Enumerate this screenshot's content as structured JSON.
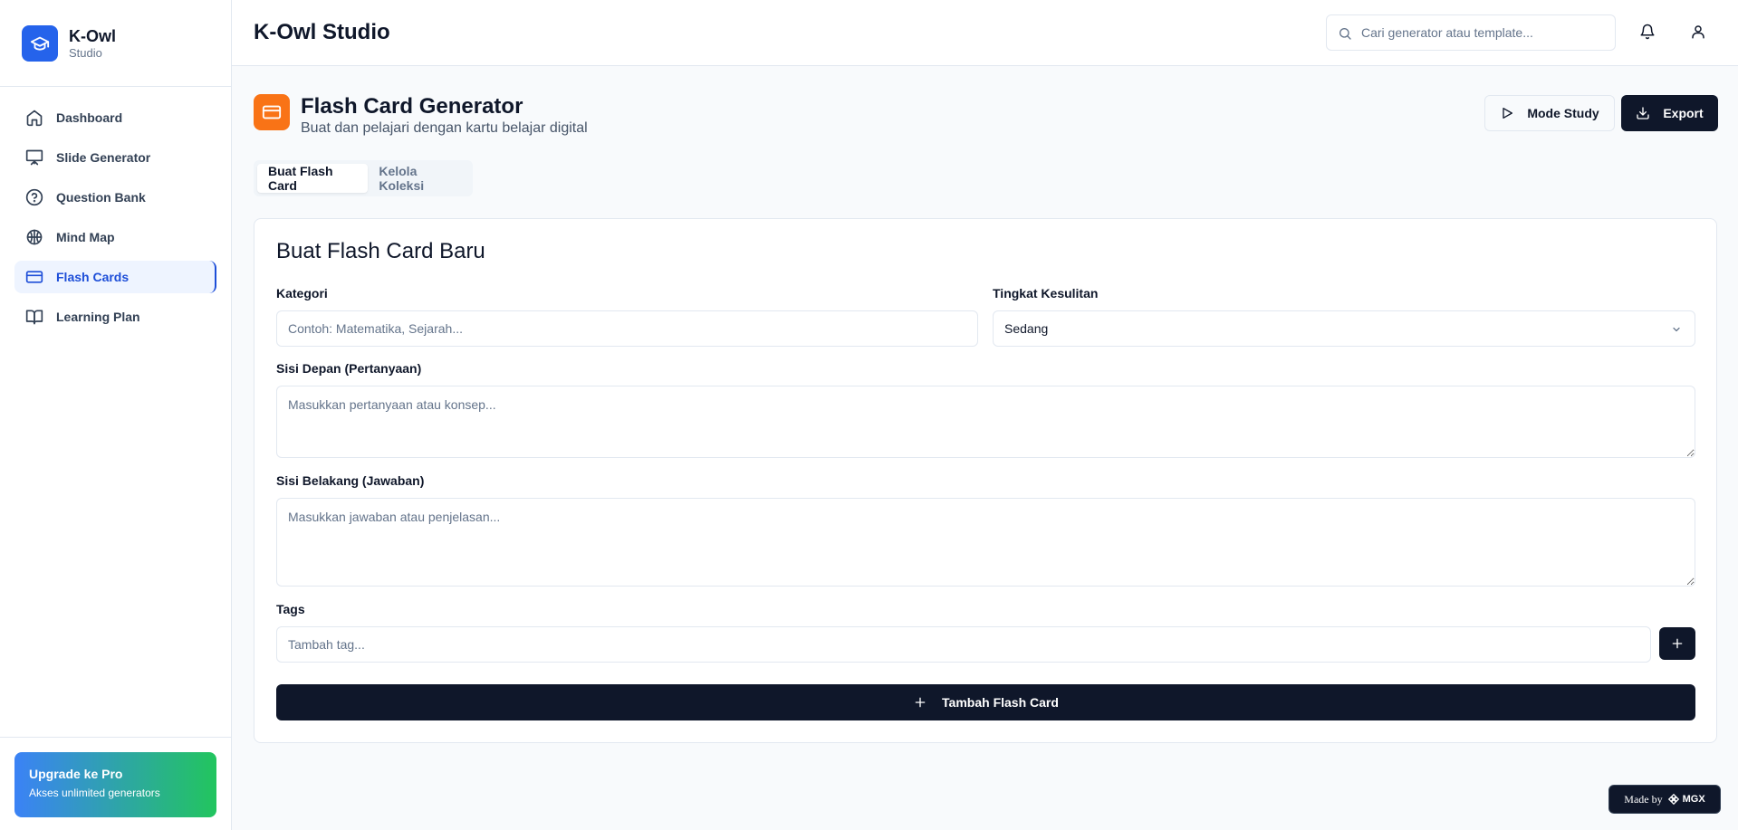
{
  "brand": {
    "name": "K-Owl",
    "sub": "Studio"
  },
  "sidebar": {
    "items": [
      {
        "label": "Dashboard",
        "icon": "home-icon"
      },
      {
        "label": "Slide Generator",
        "icon": "presentation-icon"
      },
      {
        "label": "Question Bank",
        "icon": "help-circle-icon"
      },
      {
        "label": "Mind Map",
        "icon": "brain-icon"
      },
      {
        "label": "Flash Cards",
        "icon": "credit-card-icon",
        "active": true
      },
      {
        "label": "Learning Plan",
        "icon": "book-open-icon"
      }
    ],
    "upgrade": {
      "title": "Upgrade ke Pro",
      "sub": "Akses unlimited generators"
    }
  },
  "header": {
    "title": "K-Owl Studio",
    "search_placeholder": "Cari generator atau template..."
  },
  "page": {
    "title": "Flash Card Generator",
    "subtitle": "Buat dan pelajari dengan kartu belajar digital",
    "mode_study_label": "Mode Study",
    "export_label": "Export",
    "accent": "#f97316"
  },
  "tabs": [
    {
      "label": "Buat Flash Card",
      "active": true
    },
    {
      "label": "Kelola Koleksi",
      "active": false
    }
  ],
  "form": {
    "title": "Buat Flash Card Baru",
    "kategori_label": "Kategori",
    "kategori_placeholder": "Contoh: Matematika, Sejarah...",
    "kategori_value": "",
    "difficulty_label": "Tingkat Kesulitan",
    "difficulty_value": "Sedang",
    "front_label": "Sisi Depan (Pertanyaan)",
    "front_placeholder": "Masukkan pertanyaan atau konsep...",
    "back_label": "Sisi Belakang (Jawaban)",
    "back_placeholder": "Masukkan jawaban atau penjelasan...",
    "tags_label": "Tags",
    "tags_placeholder": "Tambah tag...",
    "submit_label": "Tambah Flash Card"
  },
  "badge": {
    "made_by": "Made by",
    "brand": "MGX"
  },
  "colors": {
    "primary": "#0f172a",
    "brand_blue": "#2563eb",
    "active_nav": "#1d4ed8"
  }
}
